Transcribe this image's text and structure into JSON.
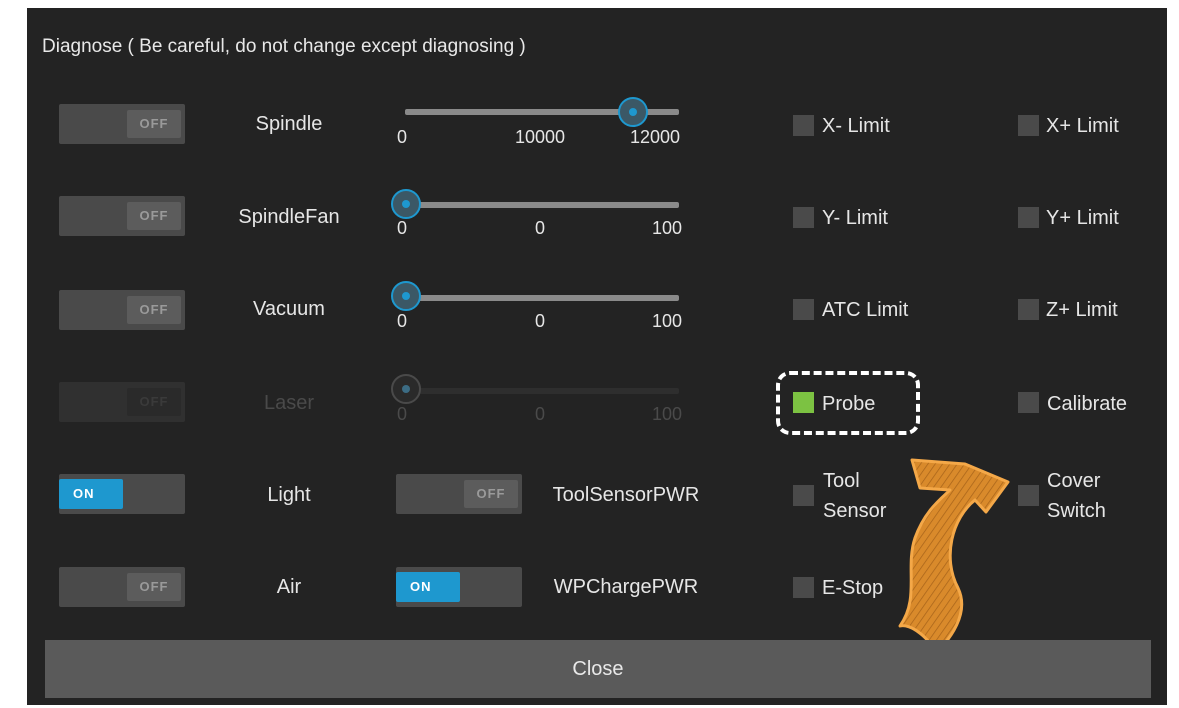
{
  "dialog": {
    "title": "Diagnose ( Be careful, do not change except diagnosing )",
    "close_label": "Close"
  },
  "switch_text": {
    "off": "OFF",
    "on": "ON"
  },
  "rows": {
    "spindle": {
      "label": "Spindle",
      "state": "OFF",
      "ticks": [
        "0",
        "10000",
        "12000"
      ],
      "value": 11000
    },
    "spindlefan": {
      "label": "SpindleFan",
      "state": "OFF",
      "ticks": [
        "0",
        "0",
        "100"
      ],
      "value": 0
    },
    "vacuum": {
      "label": "Vacuum",
      "state": "OFF",
      "ticks": [
        "0",
        "0",
        "100"
      ],
      "value": 0
    },
    "laser": {
      "label": "Laser",
      "state": "OFF",
      "disabled": true,
      "ticks": [
        "0",
        "0",
        "100"
      ],
      "value": 0
    },
    "light": {
      "label": "Light",
      "state": "ON"
    },
    "air": {
      "label": "Air",
      "state": "OFF"
    },
    "toolsensorpwr": {
      "label": "ToolSensorPWR",
      "state": "OFF"
    },
    "wpchargepwr": {
      "label": "WPChargePWR",
      "state": "ON"
    }
  },
  "indicators": {
    "x_minus": {
      "label": "X- Limit",
      "active": false
    },
    "x_plus": {
      "label": "X+ Limit",
      "active": false
    },
    "y_minus": {
      "label": "Y- Limit",
      "active": false
    },
    "y_plus": {
      "label": "Y+ Limit",
      "active": false
    },
    "atc": {
      "label": "ATC Limit",
      "active": false
    },
    "z_plus": {
      "label": "Z+ Limit",
      "active": false
    },
    "probe": {
      "label": "Probe",
      "active": true
    },
    "calibrate": {
      "label": "Calibrate",
      "active": false
    },
    "tool_sensor": {
      "line1": "Tool",
      "line2": "Sensor",
      "active": false
    },
    "cover_switch": {
      "line1": "Cover",
      "line2": "Switch",
      "active": false
    },
    "estop": {
      "label": "E-Stop",
      "active": false
    }
  },
  "colors": {
    "background": "#232323",
    "accent": "#1e98cf",
    "active_indicator": "#7cc242",
    "arrow": "#d98a2b"
  }
}
